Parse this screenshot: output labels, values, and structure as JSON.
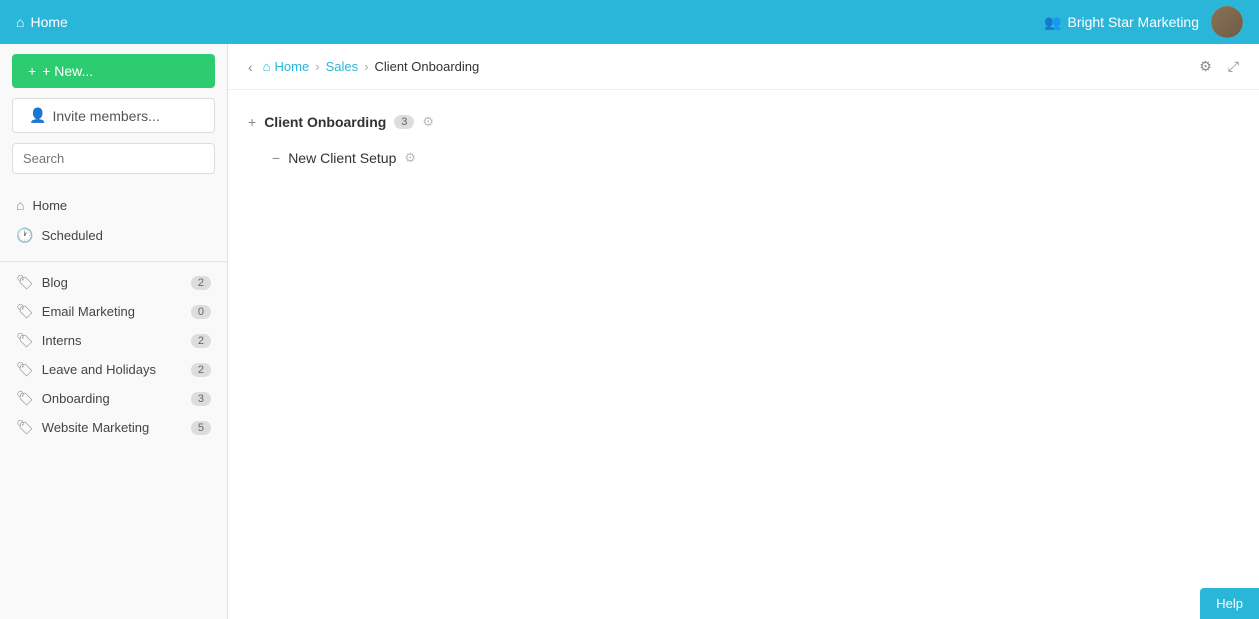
{
  "topnav": {
    "home_label": "Home",
    "org_name": "Bright Star Marketing",
    "home_icon": "⌂",
    "people_icon": "👥"
  },
  "sidebar": {
    "new_button_label": "+ New...",
    "invite_button_label": "Invite members...",
    "search_placeholder": "Search",
    "nav_items": [
      {
        "id": "home",
        "label": "Home",
        "icon": "⌂"
      },
      {
        "id": "scheduled",
        "label": "Scheduled",
        "icon": "🕐"
      }
    ],
    "tag_items": [
      {
        "id": "blog",
        "label": "Blog",
        "count": "2"
      },
      {
        "id": "email-marketing",
        "label": "Email Marketing",
        "count": "0"
      },
      {
        "id": "interns",
        "label": "Interns",
        "count": "2"
      },
      {
        "id": "leave-and-holidays",
        "label": "Leave and Holidays",
        "count": "2"
      },
      {
        "id": "onboarding",
        "label": "Onboarding",
        "count": "3"
      },
      {
        "id": "website-marketing",
        "label": "Website Marketing",
        "count": "5"
      }
    ]
  },
  "breadcrumb": {
    "home_label": "Home",
    "sales_label": "Sales",
    "current_label": "Client Onboarding",
    "home_icon": "⌂"
  },
  "project": {
    "section_title": "Client Onboarding",
    "section_count": "3",
    "subsection_title": "New Client Setup",
    "collapse_icon": "+",
    "expand_icon": "−",
    "gear_icon": "⚙",
    "pin_icon": "⤢"
  },
  "help": {
    "label": "Help"
  }
}
